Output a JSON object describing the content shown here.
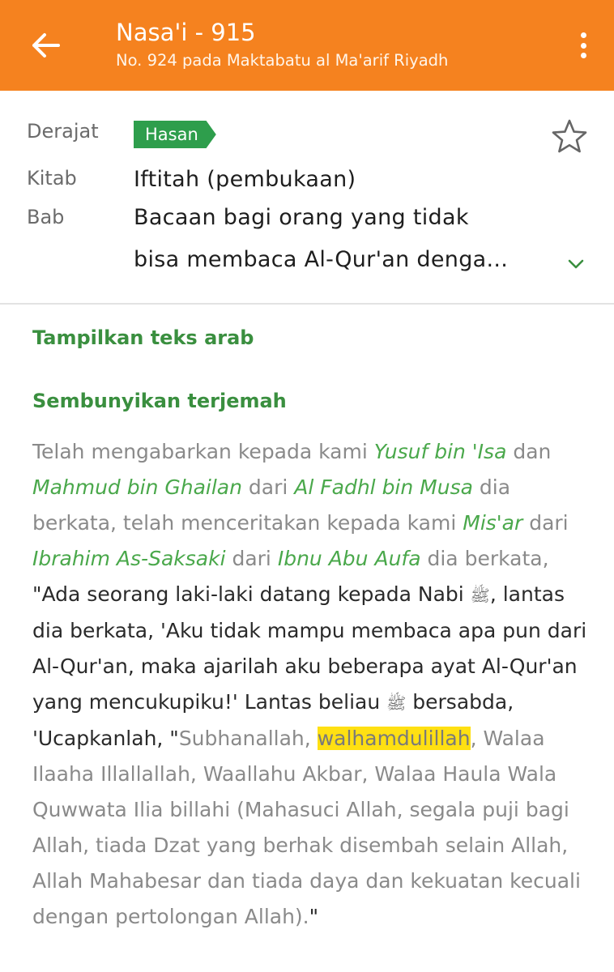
{
  "header": {
    "title": "Nasa'i - 915",
    "subtitle": "No. 924 pada Maktabatu al Ma'arif Riyadh"
  },
  "meta": {
    "derajat_label": "Derajat",
    "derajat_value": "Hasan",
    "kitab_label": "Kitab",
    "kitab_value": "Iftitah (pembukaan)",
    "bab_label": "Bab",
    "bab_value_line1": "Bacaan bagi orang yang tidak",
    "bab_value_line2": "bisa membaca Al-Qur'an denga..."
  },
  "actions": {
    "show_arabic": "Tampilkan teks arab",
    "hide_translation": "Sembunyikan terjemah"
  },
  "translation": {
    "t1": "Telah mengabarkan kepada kami ",
    "n1": "Yusuf bin 'Isa",
    "t2": " dan ",
    "n2": "Mahmud bin Ghailan",
    "t3": " dari ",
    "n3": "Al Fadhl bin Musa",
    "t4": " dia berkata, telah menceritakan kepada kami ",
    "n4": "Mis'ar",
    "t5": " dari ",
    "n5": "Ibrahim As-Saksaki",
    "t6": " dari ",
    "n6": "Ibnu Abu Aufa",
    "t7": " dia berkata, ",
    "q1": "\"Ada seorang laki-laki datang kepada Nabi ",
    "saw1": "ﷺ",
    "q2": ", lantas dia berkata, 'Aku tidak mampu membaca apa pun dari Al-Qur'an, maka ajarilah aku beberapa ayat Al-Qur'an yang mencukupiku!' Lantas beliau ",
    "saw2": "ﷺ",
    "q3": " bersabda, 'Ucapkanlah, \"",
    "d1": "Subhanallah, ",
    "hl": "walhamdulillah",
    "d2": ", Walaa Ilaaha Illallallah, Waallahu Akbar, Walaa Haula Wala Quwwata Ilia billahi (Mahasuci Allah, segala puji bagi Allah, tiada Dzat yang berhak disembah selain Allah, Allah Mahabesar dan tiada daya dan kekuatan kecuali dengan pertolongan Allah).",
    "q4": "\""
  },
  "colors": {
    "appbar": "#f5821f",
    "badge": "#2e9e4c",
    "narrator": "#4aa84b",
    "highlight": "#ffe012"
  },
  "icons": {
    "back": "arrow-left-icon",
    "more": "more-vertical-icon",
    "star": "star-outline-icon",
    "expand": "chevron-down-icon"
  }
}
